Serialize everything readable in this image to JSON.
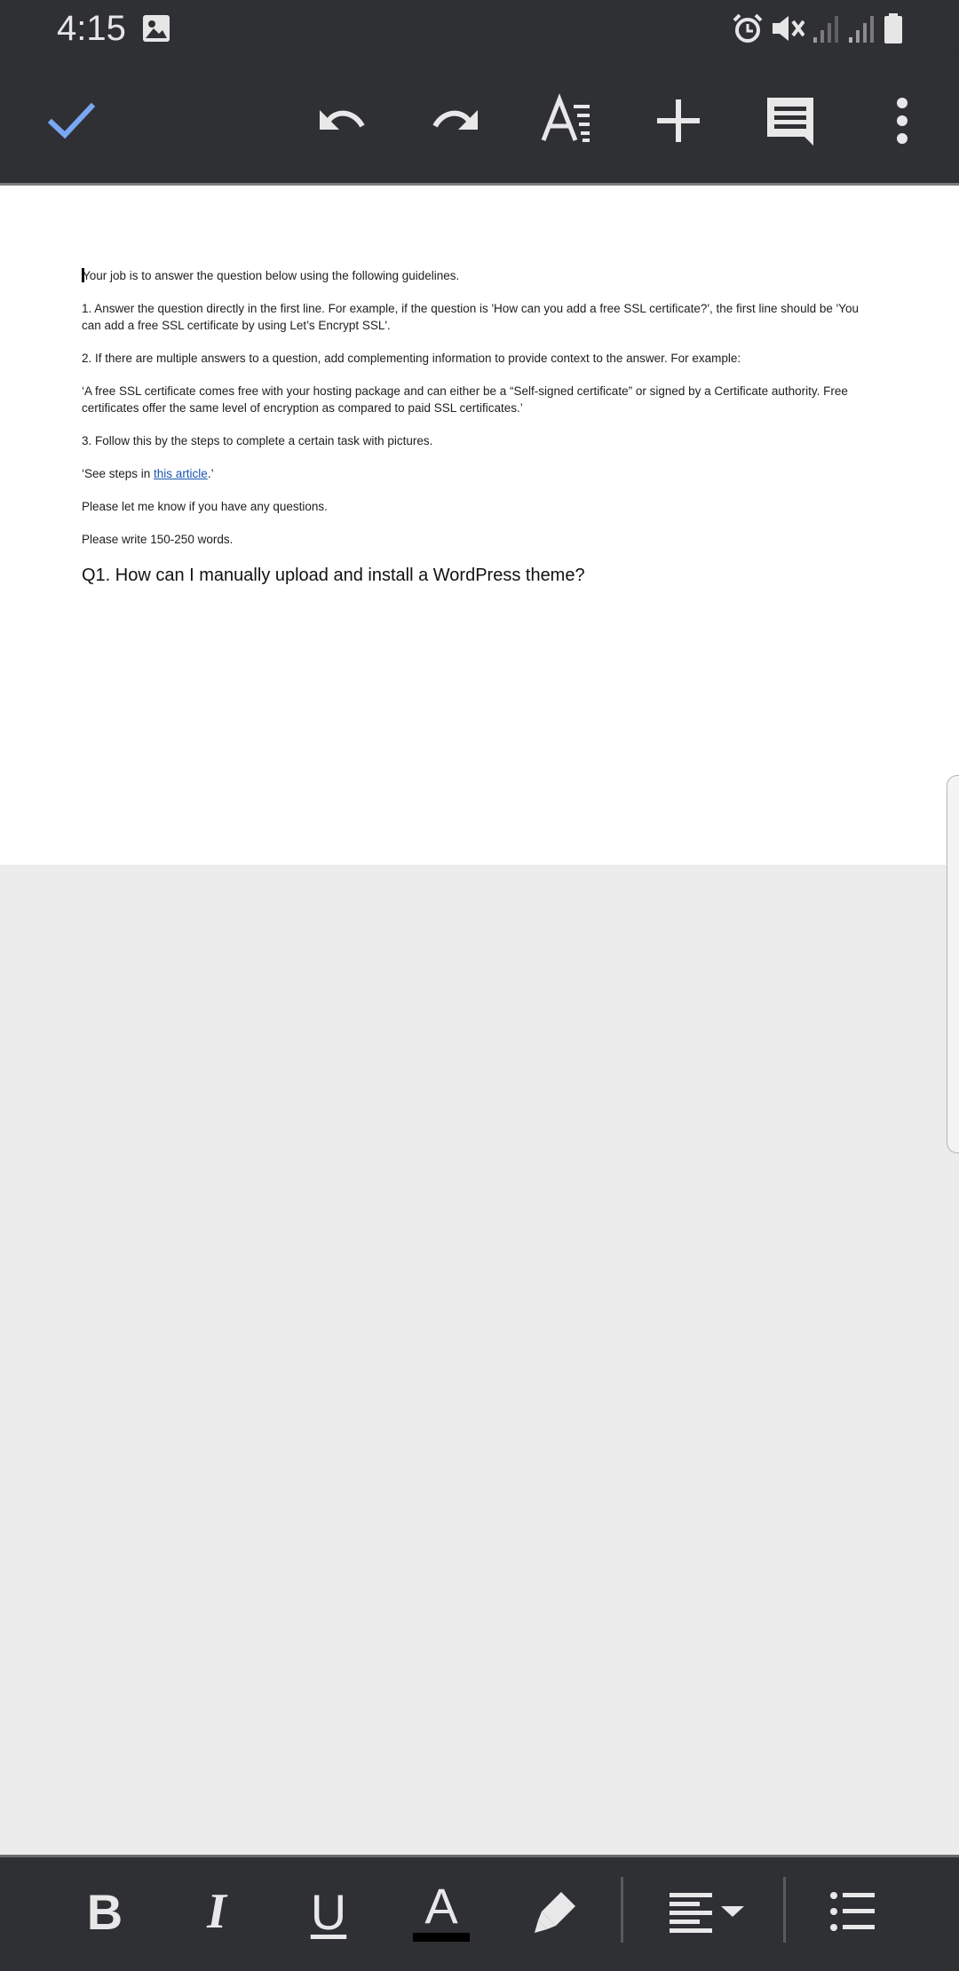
{
  "status": {
    "time": "4:15",
    "icons": [
      "image-icon",
      "alarm-icon",
      "mute-icon",
      "signal-icon",
      "signal-icon",
      "battery-icon"
    ]
  },
  "toolbar": {
    "icons": [
      "check-icon",
      "undo-icon",
      "redo-icon",
      "text-format-icon",
      "insert-plus-icon",
      "comment-icon",
      "more-vert-icon"
    ],
    "accent": "#7aa7f5"
  },
  "document": {
    "intro": "Your job is to answer the question below using the following guidelines.",
    "guideline1": "1. Answer the question directly in the first line. For example, if the question is 'How can you add a free SSL certificate?', the first line should be 'You can add a free SSL certificate by using Let’s Encrypt SSL'.",
    "guideline2": "2. If there are multiple answers to a question, add complementing information to provide context to the answer. For example:",
    "example_quote": "‘A free SSL certificate comes free with your hosting package and can either be a “Self-signed certificate” or signed by a Certificate authority. Free certificates offer the same level of encryption as compared to paid SSL certificates.’",
    "guideline3": "3. Follow this by the steps to complete a certain task with pictures.",
    "steps_prefix": "‘See steps in ",
    "steps_link": "this article",
    "steps_suffix": ".’",
    "questions_note": "Please let me know if you have any questions.",
    "word_count_note": "Please write 150-250 words.",
    "question": "Q1. How can I manually upload and install a WordPress theme?"
  },
  "format_bar": {
    "bold": "B",
    "italic": "I",
    "underline": "U",
    "text_color": "A",
    "text_color_value": "#000000",
    "icons": [
      "highlighter-icon",
      "align-left-icon",
      "dropdown-arrow-icon",
      "bulleted-list-icon"
    ]
  }
}
